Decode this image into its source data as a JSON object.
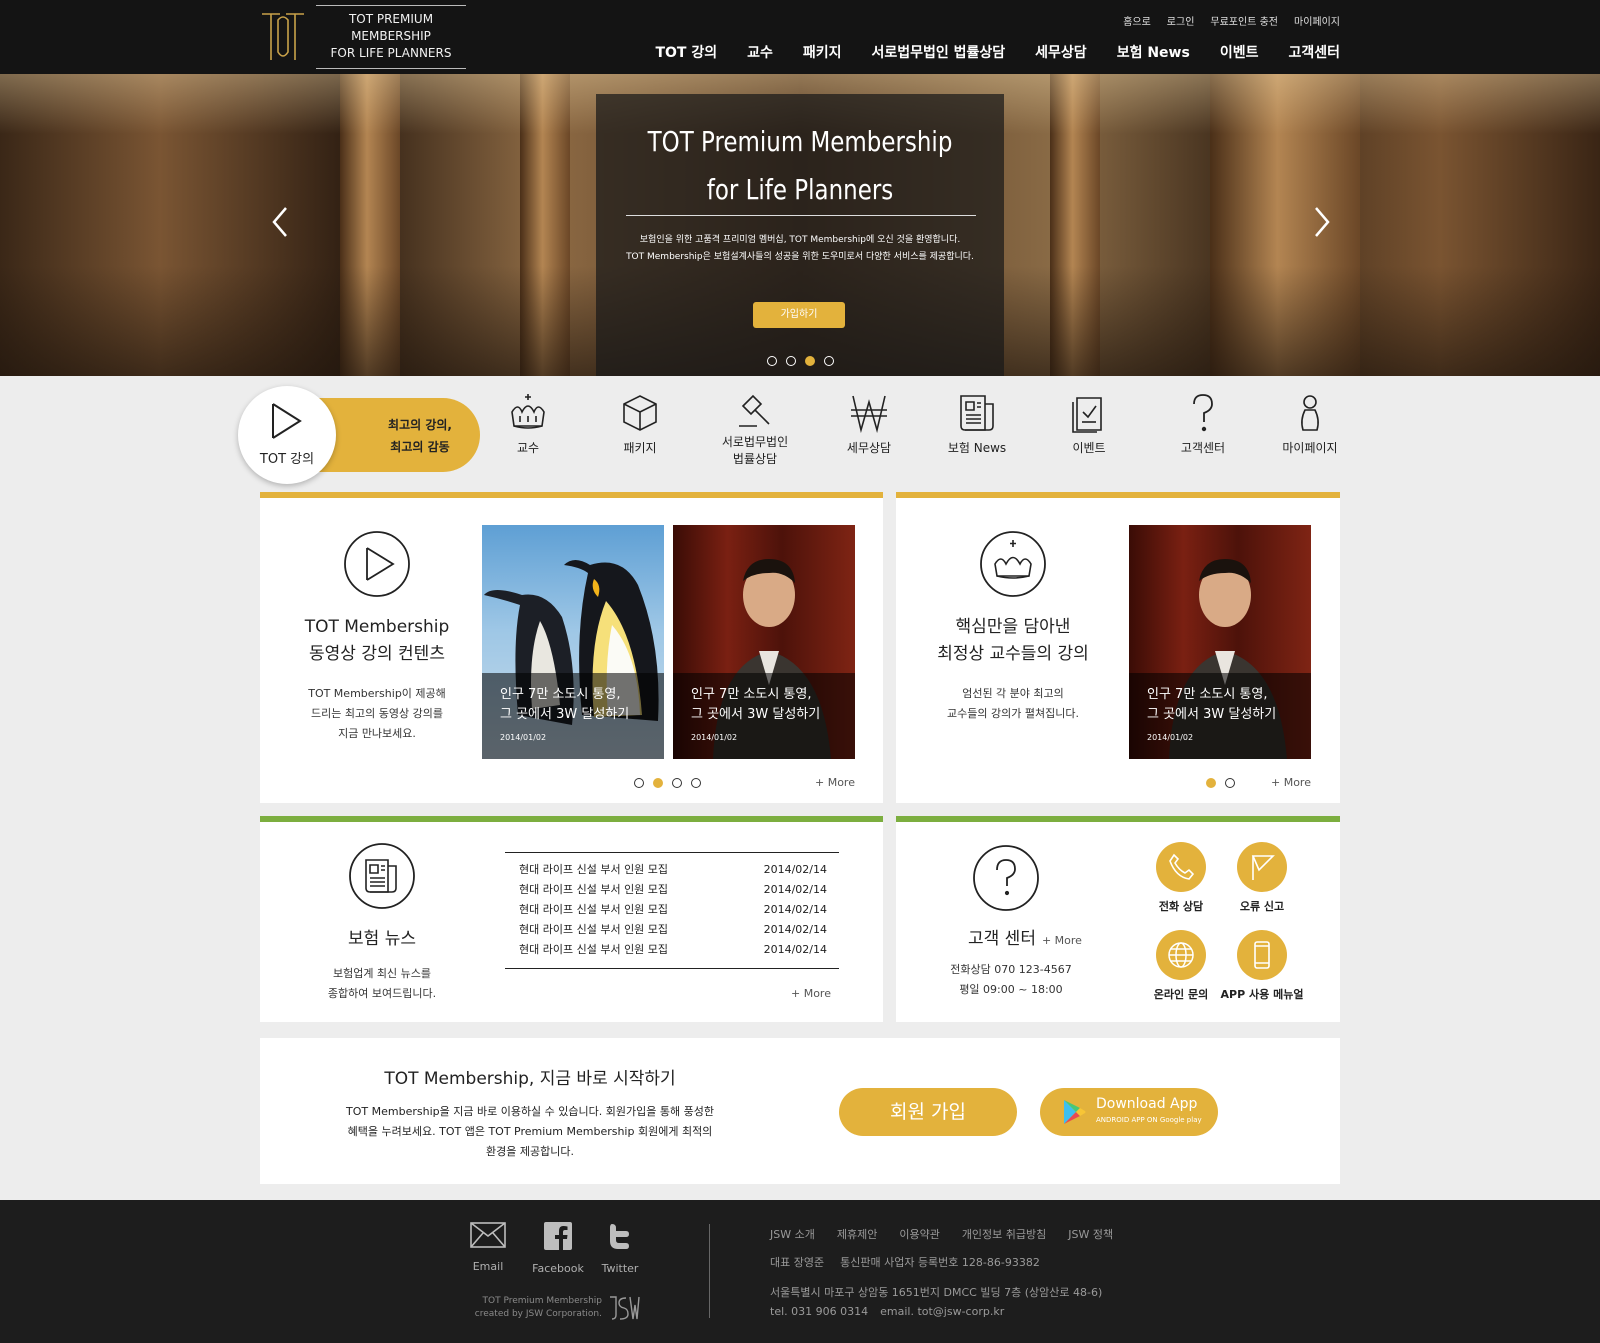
{
  "header": {
    "logo_line1": "TOT PREMIUM MEMBERSHIP",
    "logo_line2": "FOR LIFE PLANNERS",
    "util": [
      "홈으로",
      "로그인",
      "무료포인트 충전",
      "마이페이지"
    ],
    "nav": [
      "TOT 강의",
      "교수",
      "패키지",
      "서로법무법인 법률상담",
      "세무상담",
      "보험 News",
      "이벤트",
      "고객센터"
    ]
  },
  "hero": {
    "title_line1": "TOT Premium Membership",
    "title_line2": "for Life Planners",
    "desc_line1": "보험인을 위한 고품격 프리미엄 멤버십, TOT Membership에 오신 것을 환영합니다.",
    "desc_line2": "TOT Membership은 보험설계사들의 성공을 위한 도우미로서 다양한 서비스를 제공합니다.",
    "button": "가입하기",
    "slide_count": 4,
    "active_slide": 3
  },
  "quick_menu": {
    "active": {
      "label": "TOT 강의",
      "tag_line1": "최고의 강의,",
      "tag_line2": "최고의 감동"
    },
    "items": [
      {
        "label": "교수",
        "icon": "crown-icon"
      },
      {
        "label": "패키지",
        "icon": "box-icon"
      },
      {
        "label": "서로법무법인\n법률상담",
        "label1": "서로법무법인",
        "label2": "법률상담",
        "icon": "gavel-icon"
      },
      {
        "label": "세무상담",
        "icon": "won-icon"
      },
      {
        "label": "보험 News",
        "icon": "newspaper-icon"
      },
      {
        "label": "이벤트",
        "icon": "checklist-icon"
      },
      {
        "label": "고객센터",
        "icon": "question-icon"
      },
      {
        "label": "마이페이지",
        "icon": "person-icon"
      }
    ]
  },
  "lecture_card": {
    "title_line1": "TOT Membership",
    "title_line2": "동영상 강의 컨텐츠",
    "desc_line1": "TOT Membership이 제공해",
    "desc_line2": "드리는 최고의 동영상 강의를",
    "desc_line3": "지금 만나보세요.",
    "slides": [
      {
        "title_line1": "인구 7만 소도시 통영,",
        "title_line2": "그 곳에서 3W 달성하기",
        "date": "2014/01/02"
      },
      {
        "title_line1": "인구 7만 소도시 통영,",
        "title_line2": "그 곳에서 3W 달성하기",
        "date": "2014/01/02"
      }
    ],
    "page_count": 4,
    "active_page": 2,
    "more": "+ More"
  },
  "professor_card": {
    "title_line1": "핵심만을 담아낸",
    "title_line2": "최정상 교수들의 강의",
    "desc_line1": "엄선된 각 분야 최고의",
    "desc_line2": "교수들의 강의가 펼쳐집니다.",
    "slide": {
      "title_line1": "인구 7만 소도시 통영,",
      "title_line2": "그 곳에서 3W 달성하기",
      "date": "2014/01/02"
    },
    "page_count": 2,
    "active_page": 1,
    "more": "+ More"
  },
  "news_card": {
    "title": "보험 뉴스",
    "desc_line1": "보험업계 최신 뉴스를",
    "desc_line2": "종합하여 보여드립니다.",
    "rows": [
      {
        "title": "현대 라이프 신설 부서 인원 모집",
        "date": "2014/02/14"
      },
      {
        "title": "현대 라이프 신설 부서 인원 모집",
        "date": "2014/02/14"
      },
      {
        "title": "현대 라이프 신설 부서 인원 모집",
        "date": "2014/02/14"
      },
      {
        "title": "현대 라이프 신설 부서 인원 모집",
        "date": "2014/02/14"
      },
      {
        "title": "현대 라이프 신설 부서 인원 모집",
        "date": "2014/02/14"
      }
    ],
    "more": "+ More"
  },
  "support_card": {
    "title": "고객 센터",
    "more": "+ More",
    "phone": "전화상담 070 123-4567",
    "hours": "평일 09:00 ~ 18:00",
    "actions": [
      "전화 상담",
      "오류 신고",
      "온라인 문의",
      "APP 사용 메뉴얼"
    ]
  },
  "promo": {
    "title": "TOT Membership, 지금 바로 시작하기",
    "desc_line1": "TOT Membership을 지금 바로 이용하실 수 있습니다. 회원가입을 통해 풍성한",
    "desc_line2": "혜택을 누려보세요. TOT 앱은 TOT Premium Membership 회원에게 최적의",
    "desc_line3": "환경을 제공합니다.",
    "join_button": "회원 가입",
    "app_button": "Download App",
    "app_sub": "ANDROID APP ON Google play"
  },
  "footer": {
    "sns": [
      "Email",
      "Facebook",
      "Twitter"
    ],
    "credit_line1": "TOT Premium Membership",
    "credit_line2": "created by JSW Corporation.",
    "links": [
      "JSW 소개",
      "제휴제안",
      "이용약관",
      "개인정보 취급방침",
      "JSW 정책"
    ],
    "ceo": "대표 장영준",
    "biz": "통신판매 사업자 등록번호 128-86-93382",
    "address": "서울특별시 마포구 상암동 1651번지 DMCC 빌딩 7층 (상암산로 48-6)",
    "tel": "tel. 031 906 0314",
    "email": "email. tot@jsw-corp.kr"
  },
  "colors": {
    "accent": "#e3b23c",
    "green": "#7cae3f",
    "header": "#141414",
    "footer": "#1d1d1d"
  }
}
